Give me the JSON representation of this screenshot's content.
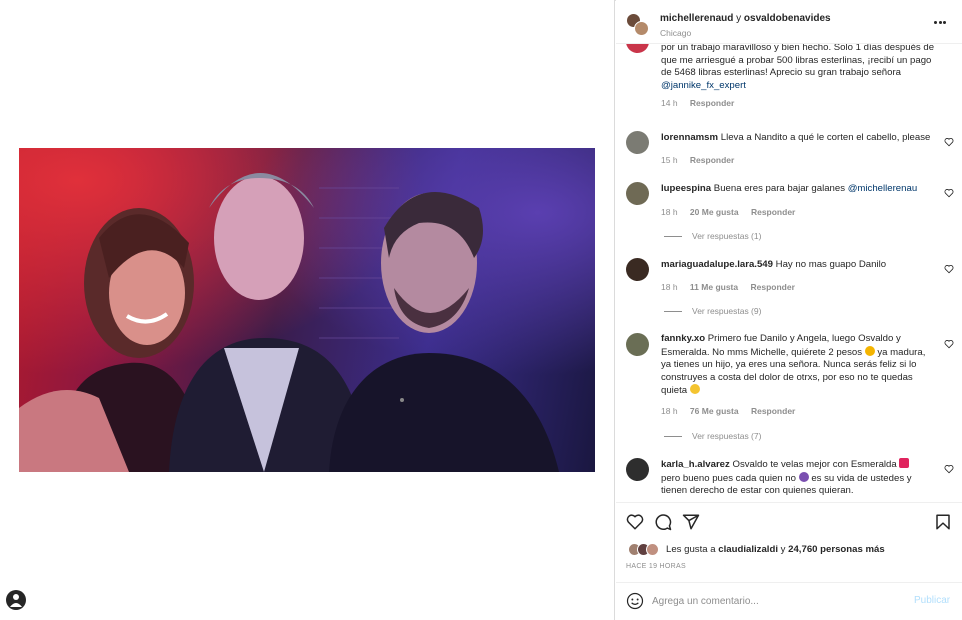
{
  "post": {
    "header": {
      "user1": "michellerenaud",
      "conjunction": "y",
      "user2": "osvaldobenavides",
      "location": "Chicago"
    },
    "comments": [
      {
        "text": "por un trabajo maravilloso y bien hecho. Solo 1 días después de que me arriesgué a probar 500 libras esterlinas, ¡recibí un pago de 5468 libras esterlinas! Aprecio su gran trabajo señora",
        "mention": "@jannike_fx_expert",
        "time": "14 h",
        "reply": "Responder"
      },
      {
        "user": "lorennamsm",
        "text": "Lleva a Nandito a qué le corten el cabello, please",
        "time": "15 h",
        "reply": "Responder"
      },
      {
        "user": "lupeespina",
        "text": "Buena eres para bajar galanes",
        "mention": "@michellerenau",
        "time": "18 h",
        "likes": "20 Me gusta",
        "reply": "Responder",
        "view_replies": "Ver respuestas (1)"
      },
      {
        "user": "mariaguadalupe.lara.549",
        "text": "Hay no mas guapo Danilo",
        "time": "18 h",
        "likes": "11 Me gusta",
        "reply": "Responder",
        "view_replies": "Ver respuestas (9)"
      },
      {
        "user": "fannky.xo",
        "text_a": "Primero fue Danilo y Angela, luego Osvaldo y Esmeralda. No mms Michelle, quiérete 2 pesos",
        "text_b": "ya madura, ya tienes un hijo, ya eres una señora. Nunca serás feliz si lo construyes a costa del dolor de otrxs, por eso no te quedas quieta",
        "time": "18 h",
        "likes": "76 Me gusta",
        "reply": "Responder",
        "view_replies": "Ver respuestas (7)"
      },
      {
        "user": "karla_h.alvarez",
        "text_a": "Osvaldo te velas mejor con Esmeralda",
        "text_b": "pero bueno pues cada quien no",
        "text_c": "es su vida de ustedes y tienen derecho de estar con quienes quieran."
      }
    ],
    "likes": {
      "prefix": "Les gusta a",
      "user": "claudializaldi",
      "middle": "y",
      "count": "24,760 personas más"
    },
    "time_ago": "HACE 19 HORAS",
    "add_comment": {
      "placeholder": "Agrega un comentario...",
      "publish": "Publicar"
    },
    "colors": {
      "link": "#00376b",
      "muted": "#8e8e8e",
      "publish_disabled": "#b2dffc",
      "text": "#262626"
    },
    "icons": [
      "heart-icon",
      "comment-icon",
      "share-icon",
      "bookmark-icon",
      "more-options-icon",
      "emoji-smile-icon"
    ]
  }
}
